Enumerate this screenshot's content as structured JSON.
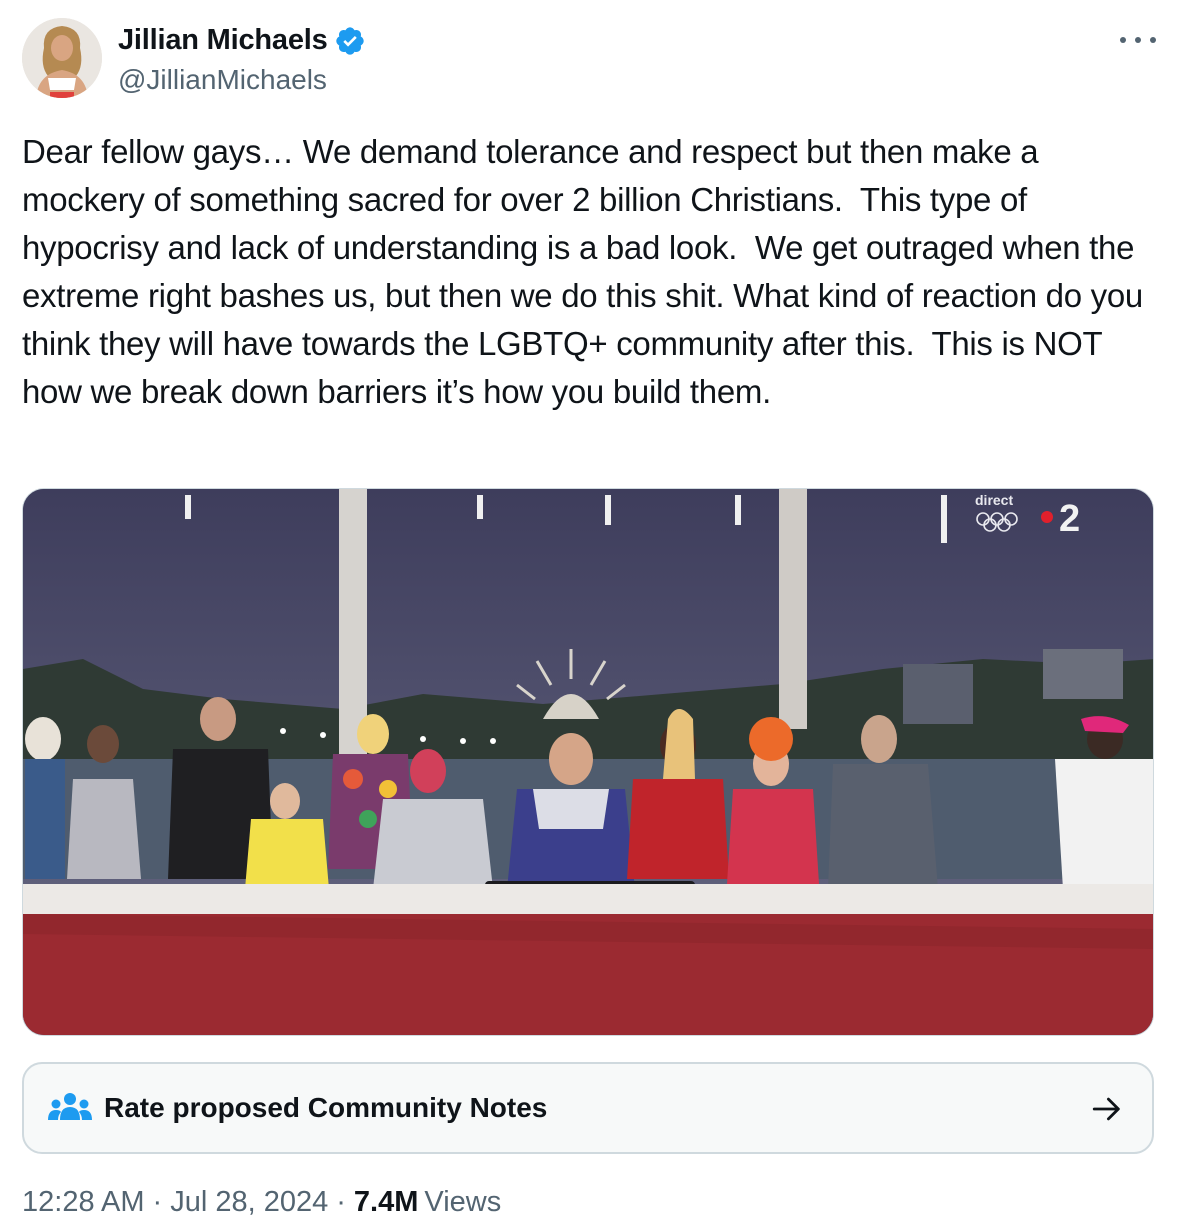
{
  "tweet": {
    "author": {
      "display_name": "Jillian Michaels",
      "handle": "@JillianMichaels",
      "verified": true,
      "verified_color": "#1d9bf0"
    },
    "text": "Dear fellow gays… We demand tolerance and respect but then make a mockery of something sacred for over 2 billion Christians.  This type of hypocrisy and lack of understanding is a bad look.  We get outraged when the extreme right bashes us, but then we do this shit. What kind of reaction do you think they will have towards the LGBTQ+ community after this.  This is NOT how we break down barriers it’s how you build them.",
    "media": {
      "broadcast_badge": "direct",
      "channel_number": "2"
    },
    "community_notes": {
      "label": "Rate proposed Community Notes",
      "icon": "people-icon",
      "arrow_icon": "arrow-right-icon"
    },
    "time": "12:28 AM",
    "date": "Jul 28, 2024",
    "separator": "·",
    "views_count": "7.4M",
    "views_label": "Views"
  },
  "colors": {
    "text_primary": "#0f1419",
    "text_secondary": "#536471",
    "accent": "#1d9bf0",
    "card_bg": "#f7f9f9",
    "border": "#cfd9de"
  }
}
